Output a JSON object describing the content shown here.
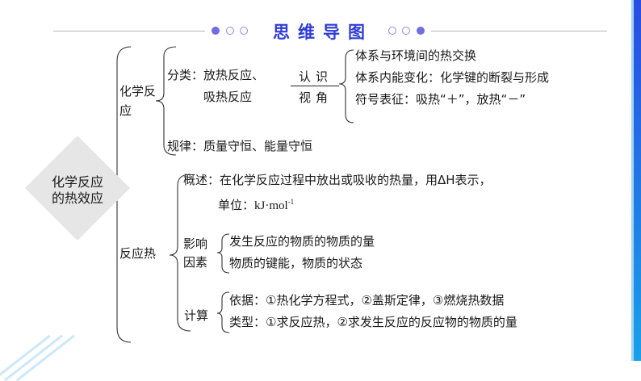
{
  "header": {
    "title": "思维导图",
    "accent_color": "#2f3cd8",
    "dot_color": "#6f6ee0"
  },
  "root": {
    "line1": "化学反应",
    "line2": "的热效应"
  },
  "branch_chem": {
    "label_line1": "化学反",
    "label_line2": "应",
    "classify_label": "分类：",
    "classify_item1": "放热反应、",
    "classify_item2": "吸热反应",
    "recognize_top": "认识",
    "recognize_bottom": "视角",
    "views": [
      "体系与环境间的热交换",
      "体系内能变化：化学键的断裂与形成",
      "符号表征：吸热“＋”，放热“－”"
    ],
    "law": "规律：质量守恒、能量守恒"
  },
  "branch_heat": {
    "label": "反应热",
    "overview_line1": "概述：在化学反应过程中放出或吸收的热量，用ΔH表示，",
    "overview_unit_label": "单位：",
    "overview_unit": "kJ·mol",
    "overview_unit_exp": "-1",
    "factors_label_line1": "影响",
    "factors_label_line2": "因素",
    "factors": [
      "发生反应的物质的物质的量",
      "物质的键能，物质的状态"
    ],
    "calc_label": "计算",
    "calc": [
      "依据：①热化学方程式，②盖斯定律，③燃烧热数据",
      "类型：①求反应热，②求发生反应的反应物的物质的量"
    ]
  }
}
